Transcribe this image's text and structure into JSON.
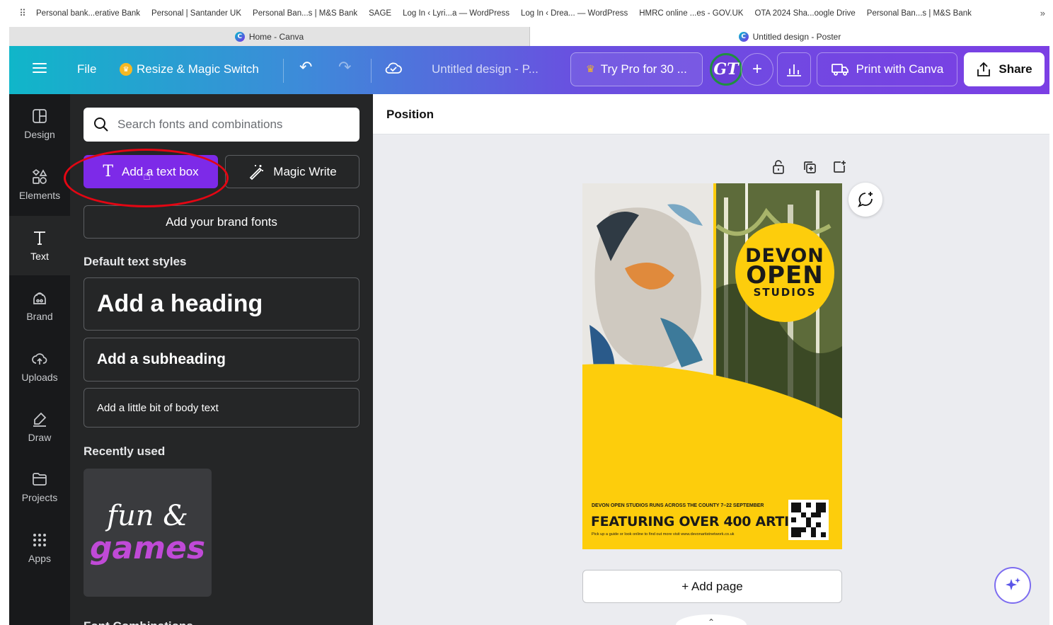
{
  "bookmarks": {
    "items": [
      "Personal bank...erative Bank",
      "Personal | Santander UK",
      "Personal Ban...s | M&S Bank",
      "SAGE",
      "Log In ‹ Lyri...a — WordPress",
      "Log In ‹ Drea... — WordPress",
      "HMRC online ...es - GOV.UK",
      "OTA 2024 Sha...oogle Drive",
      "Personal Ban...s | M&S Bank"
    ],
    "more": "»"
  },
  "tabs": [
    {
      "title": "Home - Canva"
    },
    {
      "title": "Untitled design - Poster"
    }
  ],
  "header": {
    "file": "File",
    "resize": "Resize & Magic Switch",
    "doc_title": "Untitled design - P...",
    "try_pro": "Try Pro for 30 ...",
    "avatar": "GT",
    "plus": "+",
    "print": "Print with Canva",
    "share": "Share"
  },
  "rail": [
    {
      "label": "Design",
      "icon": "design-icon"
    },
    {
      "label": "Elements",
      "icon": "elements-icon"
    },
    {
      "label": "Text",
      "icon": "text-icon",
      "active": true
    },
    {
      "label": "Brand",
      "icon": "brand-icon"
    },
    {
      "label": "Uploads",
      "icon": "uploads-icon"
    },
    {
      "label": "Draw",
      "icon": "draw-icon"
    },
    {
      "label": "Projects",
      "icon": "projects-icon"
    },
    {
      "label": "Apps",
      "icon": "apps-icon"
    }
  ],
  "panel": {
    "search_placeholder": "Search fonts and combinations",
    "add_text_box": "Add a text box",
    "magic_write": "Magic Write",
    "brand_fonts": "Add your brand fonts",
    "default_styles": "Default text styles",
    "heading": "Add a heading",
    "subheading": "Add a subheading",
    "body": "Add a little bit of body text",
    "recently_used": "Recently used",
    "recent_line1": "fun &",
    "recent_line2": "games",
    "font_combinations": "Font Combinations"
  },
  "canvas": {
    "position": "Position",
    "add_page": "+ Add page"
  },
  "poster": {
    "logo_line1": "DEVON",
    "logo_line2": "OPEN",
    "logo_line3": "STUDIOS",
    "small_top": "DEVON OPEN STUDIOS RUNS ACROSS THE COUNTY 7–22 SEPTEMBER",
    "headline": "FEATURING OVER 400 ARTISTS",
    "small_bottom": "Pick up a guide or look online to find out more visit www.devonartistnetwork.co.uk"
  },
  "colors": {
    "accent": "#7d2ae8",
    "poster_yellow": "#fdcd0c",
    "annotation_red": "#e30613",
    "panel_bg": "#252627",
    "rail_bg": "#18191b"
  }
}
